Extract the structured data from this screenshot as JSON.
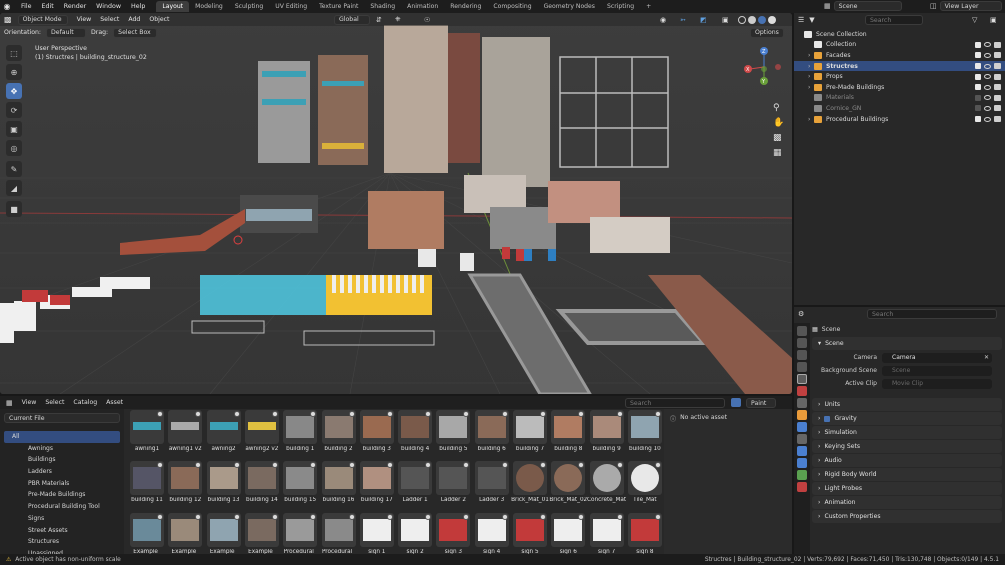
{
  "menu": [
    "File",
    "Edit",
    "Render",
    "Window",
    "Help"
  ],
  "workspaces": [
    "Layout",
    "Modeling",
    "Sculpting",
    "UV Editing",
    "Texture Paint",
    "Shading",
    "Animation",
    "Rendering",
    "Compositing",
    "Geometry Nodes",
    "Scripting",
    "+"
  ],
  "active_workspace": "Layout",
  "scene_name": "Scene",
  "view_layer": "View Layer",
  "viewport": {
    "mode": "Object Mode",
    "menus": [
      "View",
      "Select",
      "Add",
      "Object"
    ],
    "transform_orientation": "Global",
    "orientation_label": "Orientation:",
    "orientation_value": "Default",
    "drag_label": "Drag:",
    "drag_value": "Select Box",
    "options": "Options",
    "perspective": "User Perspective",
    "active_info": "(1) Structres | building_structure_02",
    "gizmo": {
      "x": "X",
      "y": "Y",
      "z": "Z"
    },
    "tools": [
      "select-box",
      "cursor",
      "move",
      "rotate",
      "scale",
      "transform",
      "annotate",
      "measure",
      "add-cube"
    ],
    "active_tool": "move"
  },
  "outliner": {
    "search_placeholder": "Search",
    "items": [
      {
        "label": "Scene Collection",
        "color": "#e8e8e8",
        "indent": 0,
        "checks": false
      },
      {
        "label": "Collection",
        "color": "#e8e8e8",
        "indent": 1,
        "checks": true,
        "on": true
      },
      {
        "label": "Facades",
        "color": "#e8a23a",
        "indent": 1,
        "checks": true,
        "on": true,
        "expand": true
      },
      {
        "label": "Structres",
        "color": "#e8a23a",
        "indent": 1,
        "checks": true,
        "on": true,
        "expand": true,
        "bold": true
      },
      {
        "label": "Props",
        "color": "#e8a23a",
        "indent": 1,
        "checks": true,
        "on": true,
        "expand": true
      },
      {
        "label": "Pre-Made Buildings",
        "color": "#e8a23a",
        "indent": 1,
        "checks": true,
        "on": true,
        "expand": true
      },
      {
        "label": "Materials",
        "color": "#8a8a8a",
        "indent": 1,
        "checks": true,
        "on": false,
        "dim": true
      },
      {
        "label": "Cornice_GN",
        "color": "#8a8a8a",
        "indent": 1,
        "checks": true,
        "on": false,
        "dim": true
      },
      {
        "label": "Procedural Buildings",
        "color": "#e8a23a",
        "indent": 1,
        "checks": true,
        "on": true,
        "expand": true
      }
    ]
  },
  "properties": {
    "search_placeholder": "Search",
    "context": "Scene",
    "section_scene": "Scene",
    "camera_label": "Camera",
    "camera_value": "Camera",
    "bg_label": "Background Scene",
    "bg_value": "Scene",
    "clip_label": "Active Clip",
    "clip_value": "Movie Clip",
    "sections": [
      "Units",
      "Gravity",
      "Simulation",
      "Keying Sets",
      "Audio",
      "Rigid Body World",
      "Light Probes",
      "Animation",
      "Custom Properties"
    ]
  },
  "asset_browser": {
    "menus": [
      "View",
      "Select",
      "Catalog",
      "Asset"
    ],
    "library": "Current File",
    "search_placeholder": "Search",
    "paint_label": "Paint",
    "no_active": "No active asset",
    "catalogs": [
      "All",
      "Awnings",
      "Buildings",
      "Ladders",
      "PBR Materials",
      "Pre-Made Buildings",
      "Procedural Building Tool",
      "Signs",
      "Street Assets",
      "Structures",
      "Unassigned"
    ],
    "assets_row1": [
      "awning1",
      "awning1 v2",
      "awning2",
      "awning2 v2",
      "building 1",
      "building 2",
      "building 3",
      "building 4",
      "building 5",
      "building 6",
      "building 7",
      "building 8",
      "building 9",
      "building 10"
    ],
    "assets_row2": [
      "building 11",
      "building 12",
      "building 13",
      "building 14",
      "building 15",
      "building 16",
      "building 17",
      "Ladder 1",
      "Ladder 2",
      "Ladder 3",
      "Brick_Mat_01",
      "Brick_Mat_02",
      "Concrete_Mat",
      "Tile_Mat"
    ],
    "assets_row3": [
      "Example_",
      "Example_",
      "Example_",
      "Example_",
      "Procedural_",
      "Procedural_",
      "sign 1",
      "sign 2",
      "sign 3",
      "sign 4",
      "sign 5",
      "sign 6",
      "sign 7",
      "sign 8"
    ]
  },
  "status": {
    "left": "Active object has non-uniform scale",
    "right": "Structres | Building_structure_02 | Verts:79,692 | Faces:71,450 | Tris:130,748 | Objects:0/149 | 4.5.1"
  }
}
